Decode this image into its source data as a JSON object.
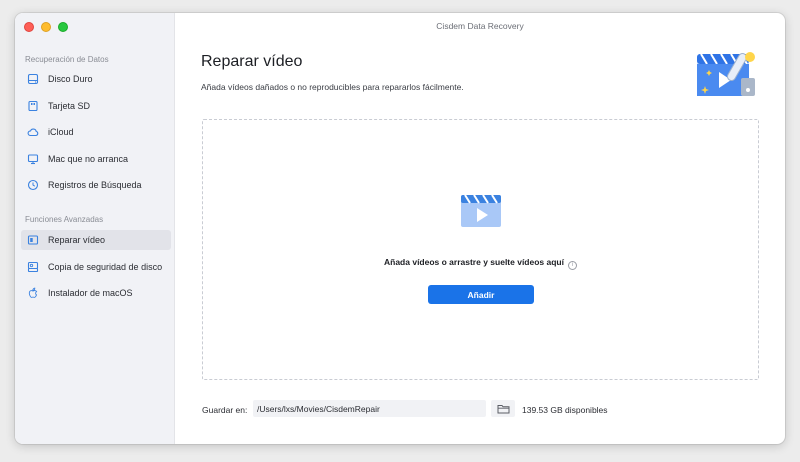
{
  "window": {
    "title": "Cisdem Data Recovery"
  },
  "sidebar": {
    "section_recovery": "Recuperación de Datos",
    "recovery_items": [
      {
        "label": "Disco Duro",
        "icon": "hard-drive-icon"
      },
      {
        "label": "Tarjeta SD",
        "icon": "sd-card-icon"
      },
      {
        "label": "iCloud",
        "icon": "cloud-icon"
      },
      {
        "label": "Mac que no arranca",
        "icon": "monitor-icon"
      },
      {
        "label": "Registros de Búsqueda",
        "icon": "clock-icon"
      }
    ],
    "section_advanced": "Funciones Avanzadas",
    "advanced_items": [
      {
        "label": "Reparar vídeo",
        "icon": "video-repair-icon",
        "active": true
      },
      {
        "label": "Copia de seguridad de disco",
        "icon": "disk-backup-icon"
      },
      {
        "label": "Instalador de macOS",
        "icon": "apple-icon"
      }
    ]
  },
  "main": {
    "title": "Reparar vídeo",
    "subtitle": "Añada vídeos dañados o no reproducibles para repararlos fácilmente.",
    "drop_text": "Añada vídeos o arrastre y suelte vídeos aquí",
    "add_button": "Añadir",
    "save_label": "Guardar en:",
    "save_path": "/Users/lxs/Movies/CisdemRepair",
    "disk_free": "139.53 GB disponibles"
  },
  "colors": {
    "accent": "#1a73e8",
    "sidebar_bg": "#f1f2f6",
    "icon_blue": "#3b82e0"
  }
}
